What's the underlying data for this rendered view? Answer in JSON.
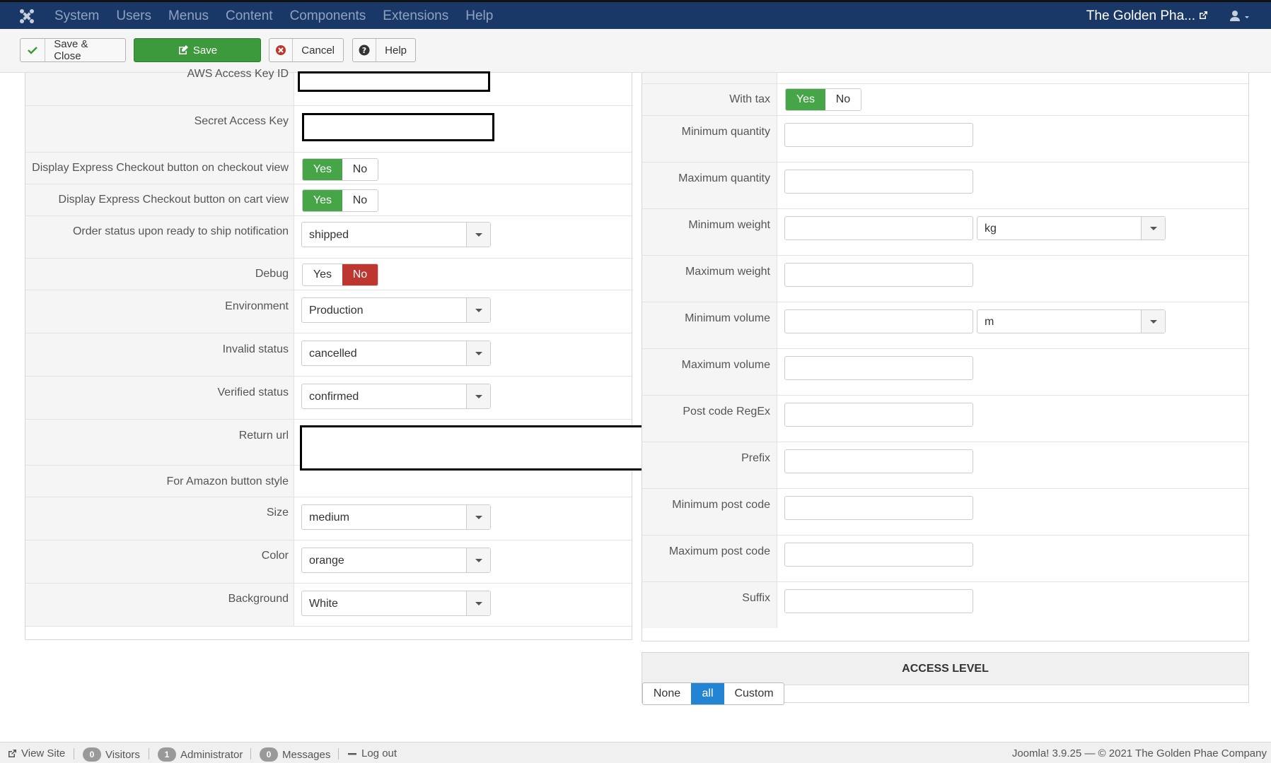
{
  "topbar": {
    "menu": [
      "System",
      "Users",
      "Menus",
      "Content",
      "Components",
      "Extensions",
      "Help"
    ],
    "site_name": "The Golden Pha..."
  },
  "toolbar": {
    "save_close": "Save & Close",
    "save": "Save",
    "cancel": "Cancel",
    "help": "Help"
  },
  "left": {
    "aws_access_key_label": "AWS Access Key ID",
    "secret_key_label": "Secret Access Key",
    "express_checkout_label": "Display Express Checkout button on checkout view",
    "express_cart_label": "Display Express Checkout button on cart view",
    "order_status_label": "Order status upon ready to ship notification",
    "order_status_value": "shipped",
    "debug_label": "Debug",
    "environment_label": "Environment",
    "environment_value": "Production",
    "invalid_status_label": "Invalid status",
    "invalid_status_value": "cancelled",
    "verified_status_label": "Verified status",
    "verified_status_value": "confirmed",
    "return_url_label": "Return url",
    "button_style_label": "For Amazon button style",
    "size_label": "Size",
    "size_value": "medium",
    "color_label": "Color",
    "color_value": "orange",
    "background_label": "Background",
    "background_value": "White",
    "yes": "Yes",
    "no": "No"
  },
  "right": {
    "with_tax_label": "With tax",
    "min_qty_label": "Minimum quantity",
    "max_qty_label": "Maximum quantity",
    "min_weight_label": "Minimum weight",
    "weight_unit": "kg",
    "max_weight_label": "Maximum weight",
    "min_volume_label": "Minimum volume",
    "volume_unit": "m",
    "max_volume_label": "Maximum volume",
    "postcode_regex_label": "Post code RegEx",
    "prefix_label": "Prefix",
    "min_postcode_label": "Minimum post code",
    "max_postcode_label": "Maximum post code",
    "suffix_label": "Suffix",
    "yes": "Yes",
    "no": "No"
  },
  "access": {
    "title": "ACCESS LEVEL",
    "none": "None",
    "all": "all",
    "custom": "Custom"
  },
  "footer": {
    "view_site": "View Site",
    "visitors_count": "0",
    "visitors": "Visitors",
    "admin_count": "1",
    "admin": "Administrator",
    "messages_count": "0",
    "messages": "Messages",
    "logout": "Log out",
    "copyright": "Joomla! 3.9.25  —  © 2021 The Golden Phae Company"
  },
  "colors": {
    "navbar": "#1a3867",
    "green": "#46a546",
    "red": "#bd362f",
    "blue": "#2384d3"
  }
}
